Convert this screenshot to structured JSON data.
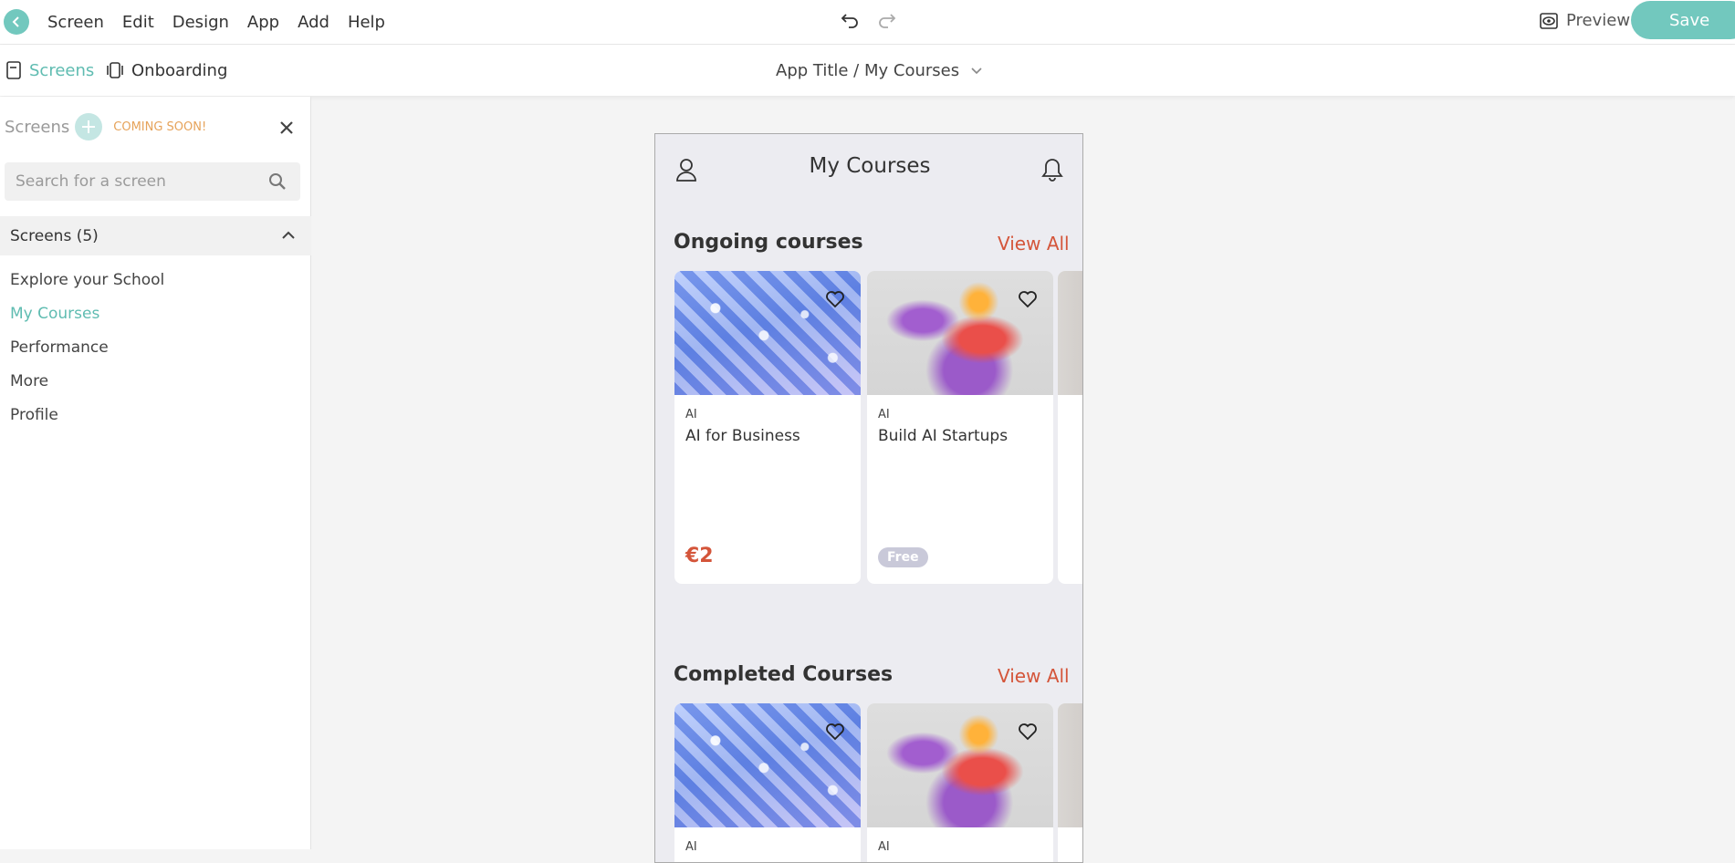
{
  "menu": {
    "items": [
      "Screen",
      "Edit",
      "Design",
      "App",
      "Add",
      "Help"
    ]
  },
  "toolbar": {
    "preview_label": "Preview",
    "save_label": "Save"
  },
  "subnav": {
    "screens_label": "Screens",
    "onboarding_label": "Onboarding",
    "breadcrumb": "App Title / My Courses"
  },
  "sidebar": {
    "title": "Screens",
    "badge": "COMING SOON!",
    "search_placeholder": "Search for a screen",
    "group_label": "Screens (5)",
    "screens": [
      "Explore your School",
      "My Courses",
      "Performance",
      "More",
      "Profile"
    ],
    "active_index": 1
  },
  "phone": {
    "title": "My Courses",
    "sections": [
      {
        "title": "Ongoing courses",
        "view_all": "View All",
        "cards": [
          {
            "category": "AI",
            "name": "AI for Business",
            "price": "€2"
          },
          {
            "category": "AI",
            "name": "Build AI Startups",
            "badge": "Free"
          }
        ]
      },
      {
        "title": "Completed Courses",
        "view_all": "View All",
        "cards": [
          {
            "category": "AI"
          },
          {
            "category": "AI"
          }
        ]
      }
    ]
  },
  "colors": {
    "accent": "#72c8be",
    "accent_light": "#c4e6e3",
    "highlight": "#d4553a",
    "coming_soon": "#e6a35a"
  }
}
